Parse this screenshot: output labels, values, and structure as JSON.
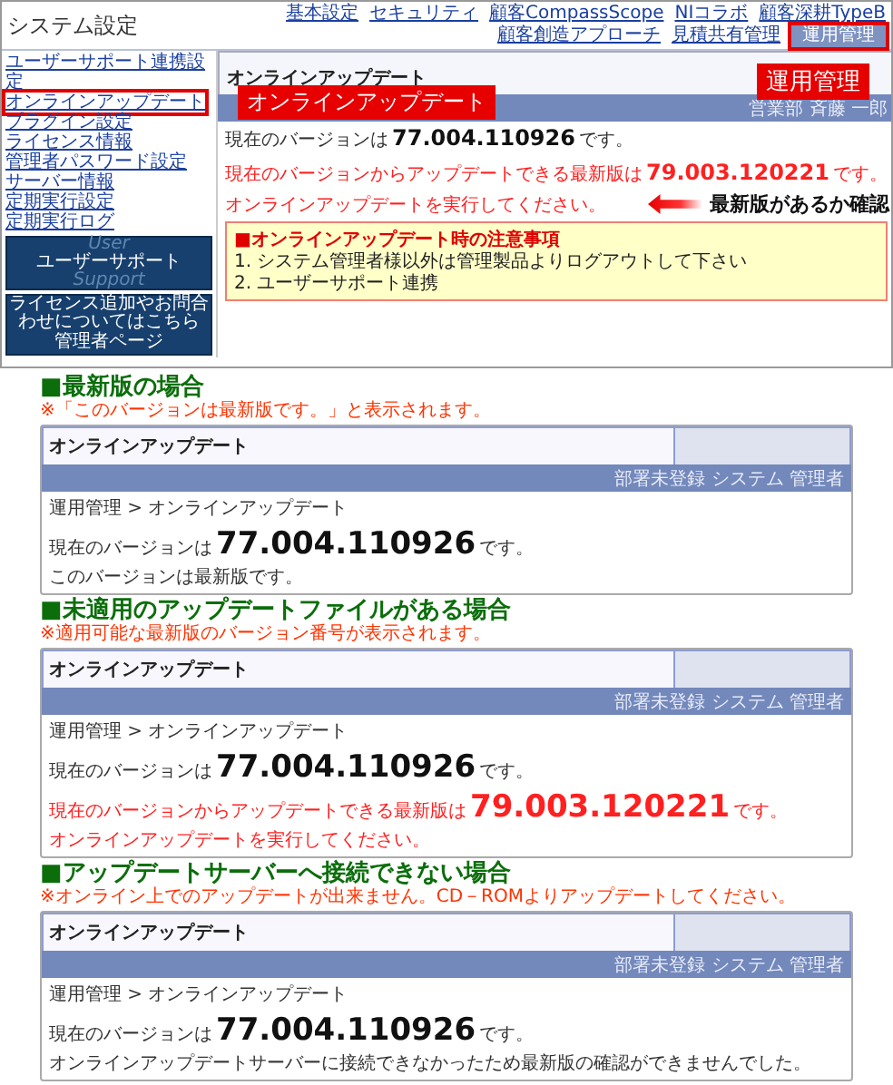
{
  "screenshot": {
    "app_title": "システム設定",
    "nav": [
      {
        "label": "基本設定",
        "selected": false
      },
      {
        "label": "セキュリティ",
        "selected": false
      },
      {
        "label": "顧客CompassScope",
        "selected": false
      },
      {
        "label": "NIコラボ",
        "selected": false
      },
      {
        "label": "顧客深耕TypeB",
        "selected": false
      },
      {
        "label": "顧客創造アプローチ",
        "selected": false
      },
      {
        "label": "見積共有管理",
        "selected": false
      },
      {
        "label": "運用管理",
        "selected": true
      }
    ],
    "sidebar": [
      {
        "label": "ユーザーサポート連携設定",
        "selected": false
      },
      {
        "label": "オンラインアップデート",
        "selected": true
      },
      {
        "label": "プラグイン設定",
        "selected": false
      },
      {
        "label": "ライセンス情報",
        "selected": false
      },
      {
        "label": "管理者パスワード設定",
        "selected": false
      },
      {
        "label": "サーバー情報",
        "selected": false
      },
      {
        "label": "定期実行設定",
        "selected": false
      },
      {
        "label": "定期実行ログ",
        "selected": false
      }
    ],
    "support_banner": {
      "top": "User",
      "title": "ユーザーサポート",
      "bottom": "Support"
    },
    "admin_banner": {
      "note": "ライセンス追加やお問合わせについてはこちら",
      "title": "管理者ページ"
    },
    "page_title": "オンラインアップデート",
    "user": "営業部 斉藤 一郎",
    "version_label": "現在のバージョンは",
    "version": "77.004.110926",
    "version_suffix": "です。",
    "update_label": "現在のバージョンからアップデートできる最新版は",
    "update_version": "79.003.120221",
    "update_suffix": "です。",
    "update_instruction": "オンラインアップデートを実行してください。",
    "notice": {
      "title": "■オンラインアップデート時の注意事項",
      "items": [
        "1. システム管理者様以外は管理製品よりログアウトして下さい",
        "2. ユーザーサポート連携"
      ]
    },
    "callouts": [
      {
        "kind": "sidebar-label",
        "text": "オンラインアップデート"
      },
      {
        "kind": "nav-label",
        "text": "運用管理"
      },
      {
        "kind": "arrow",
        "text": "最新版があるか確認"
      }
    ]
  },
  "cases": [
    {
      "heading": "■最新版の場合",
      "note": "※「このバージョンは最新版です。」と表示されます。",
      "panel": {
        "title": "オンラインアップデート",
        "user": "部署未登録 システム 管理者",
        "breadcrumb": "運用管理 > オンラインアップデート",
        "version_label": "現在のバージョンは",
        "version": "77.004.110926",
        "version_suffix": "です。",
        "messages": [
          {
            "kind": "text",
            "text": "このバージョンは最新版です。"
          }
        ]
      }
    },
    {
      "heading": "■未適用のアップデートファイルがある場合",
      "note": "※適用可能な最新版のバージョン番号が表示されます。",
      "panel": {
        "title": "オンラインアップデート",
        "user": "部署未登録 システム 管理者",
        "breadcrumb": "運用管理 > オンラインアップデート",
        "version_label": "現在のバージョンは",
        "version": "77.004.110926",
        "version_suffix": "です。",
        "messages": [
          {
            "kind": "update",
            "label": "現在のバージョンからアップデートできる最新版は",
            "version": "79.003.120221",
            "suffix": "です。"
          },
          {
            "kind": "alert",
            "text": "オンラインアップデートを実行してください。"
          }
        ]
      }
    },
    {
      "heading": "■アップデートサーバーへ接続できない場合",
      "note": "※オンライン上でのアップデートが出来ません。CD－ROMよりアップデートしてください。",
      "panel": {
        "title": "オンラインアップデート",
        "user": "部署未登録 システム 管理者",
        "breadcrumb": "運用管理 > オンラインアップデート",
        "version_label": "現在のバージョンは",
        "version": "77.004.110926",
        "version_suffix": "です。",
        "messages": [
          {
            "kind": "text",
            "text": "オンラインアップデートサーバーに接続できなかったため最新版の確認ができませんでした。"
          }
        ]
      }
    }
  ]
}
